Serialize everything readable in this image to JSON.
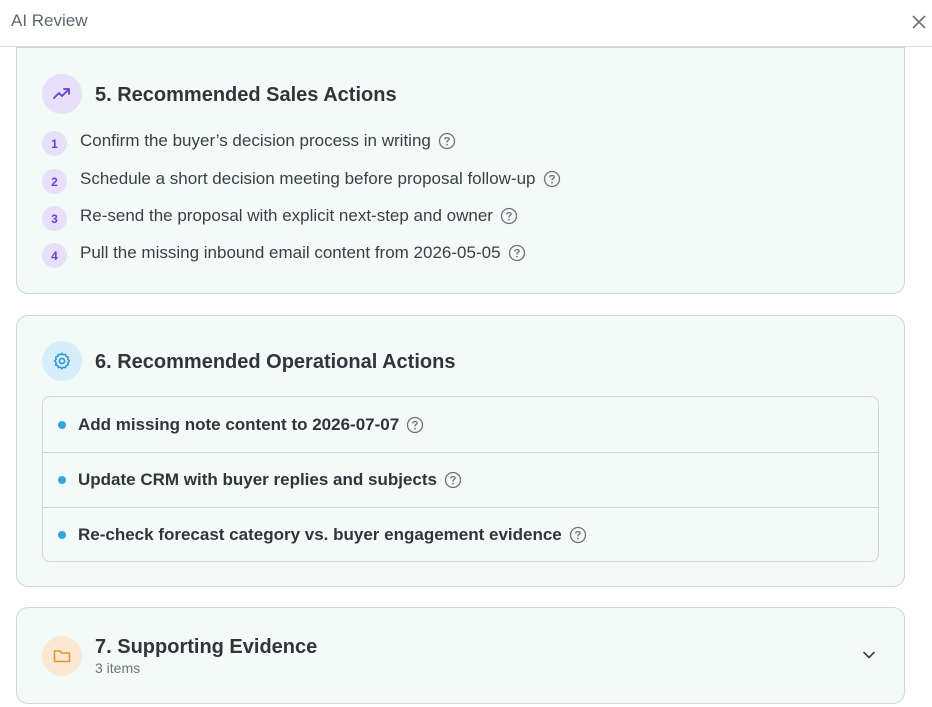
{
  "header": {
    "title": "AI Review",
    "close_icon": "close-icon"
  },
  "sales_actions": {
    "title": "5. Recommended Sales Actions",
    "icon": "trending-up-icon",
    "items": [
      {
        "number": "1",
        "text": "Confirm the buyer’s decision process in writing"
      },
      {
        "number": "2",
        "text": "Schedule a short decision meeting before proposal follow-up"
      },
      {
        "number": "3",
        "text": "Re-send the proposal with explicit next-step and owner"
      },
      {
        "number": "4",
        "text": "Pull the missing inbound email content from 2026-05-05"
      }
    ]
  },
  "operational_actions": {
    "title": "6. Recommended Operational Actions",
    "icon": "gear-icon",
    "items": [
      {
        "text": "Add missing note content to 2026-07-07"
      },
      {
        "text": "Update CRM with buyer replies and subjects"
      },
      {
        "text": "Re-check forecast category vs. buyer engagement evidence"
      }
    ]
  },
  "supporting_evidence": {
    "title": "7. Supporting Evidence",
    "subtitle": "3 items",
    "icon": "folder-icon"
  },
  "colors": {
    "card_bg": "#f2fbf8",
    "purple_accent": "#6b3fd0",
    "blue_accent": "#3aa3de",
    "orange_accent": "#e8942c"
  }
}
